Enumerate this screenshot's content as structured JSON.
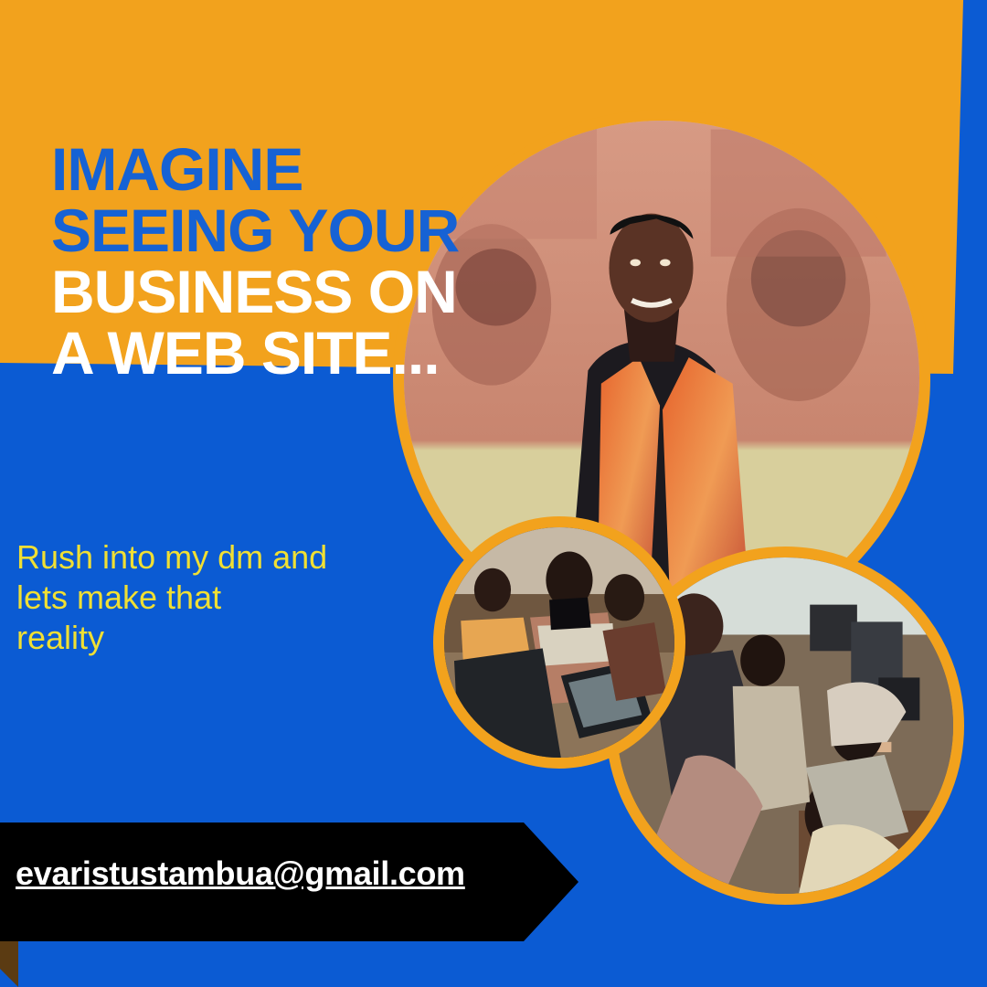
{
  "headline": {
    "line1": "IMAGINE",
    "line2": "SEEING YOUR",
    "line3": "BUSINESS ON",
    "line4": "A WEB SITE..."
  },
  "subcopy": {
    "text": "Rush into my dm and\nlets make that\n reality"
  },
  "contact": {
    "email": "evaristustambua@gmail.com"
  },
  "colors": {
    "background_blue": "#0b5bd3",
    "accent_orange": "#f2a21d",
    "headline_blue": "#1662d4",
    "headline_white": "#ffffff",
    "subcopy_yellow": "#f0df33",
    "banner_black": "#000000"
  },
  "icons": {
    "portrait": "portrait-photo",
    "group_photo_1": "group-photo",
    "group_photo_2": "classroom-photo"
  }
}
